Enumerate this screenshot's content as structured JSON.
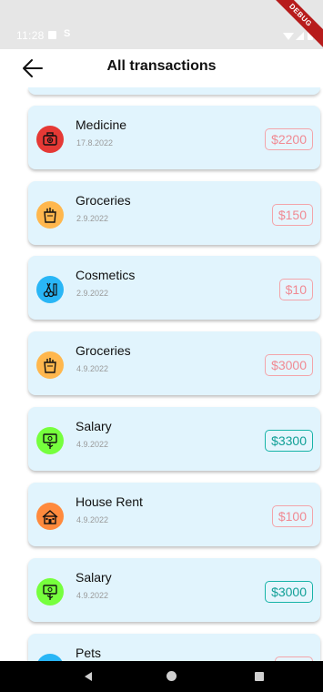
{
  "status_bar": {
    "time": "11:28",
    "carrier_glyph": "S",
    "debug_label": "DEBUG"
  },
  "app_bar": {
    "title": "All transactions",
    "back_icon": "arrow-left-icon"
  },
  "transactions": [
    {
      "name": "Medicine",
      "date": "17.8.2022",
      "amount": "$2200",
      "kind": "expense",
      "icon": "medicine-kit-icon",
      "icon_color": "#e53935"
    },
    {
      "name": "Groceries",
      "date": "2.9.2022",
      "amount": "$150",
      "kind": "expense",
      "icon": "grocery-bag-icon",
      "icon_color": "#ffb74d"
    },
    {
      "name": "Cosmetics",
      "date": "2.9.2022",
      "amount": "$10",
      "kind": "expense",
      "icon": "cosmetics-scissors-icon",
      "icon_color": "#29b6f6"
    },
    {
      "name": "Groceries",
      "date": "4.9.2022",
      "amount": "$3000",
      "kind": "expense",
      "icon": "grocery-bag-icon",
      "icon_color": "#ffb74d"
    },
    {
      "name": "Salary",
      "date": "4.9.2022",
      "amount": "$3300",
      "kind": "income",
      "icon": "money-plant-icon",
      "icon_color": "#76ff3d"
    },
    {
      "name": "House Rent",
      "date": "4.9.2022",
      "amount": "$100",
      "kind": "expense",
      "icon": "house-icon",
      "icon_color": "#ff8a3d"
    },
    {
      "name": "Salary",
      "date": "4.9.2022",
      "amount": "$3000",
      "kind": "income",
      "icon": "money-plant-icon",
      "icon_color": "#76ff3d"
    },
    {
      "name": "Pets",
      "date": "",
      "amount": "",
      "kind": "expense",
      "icon": "pet-icon",
      "icon_color": "#29b6f6"
    }
  ],
  "nav_bar": {
    "back": "nav-back-icon",
    "home": "nav-home-icon",
    "recents": "nav-recents-icon"
  },
  "colors": {
    "card_bg": "#e1f4fd",
    "expense": "#f08a93",
    "income": "#109f96",
    "status_bar": "#e6e6e6"
  }
}
